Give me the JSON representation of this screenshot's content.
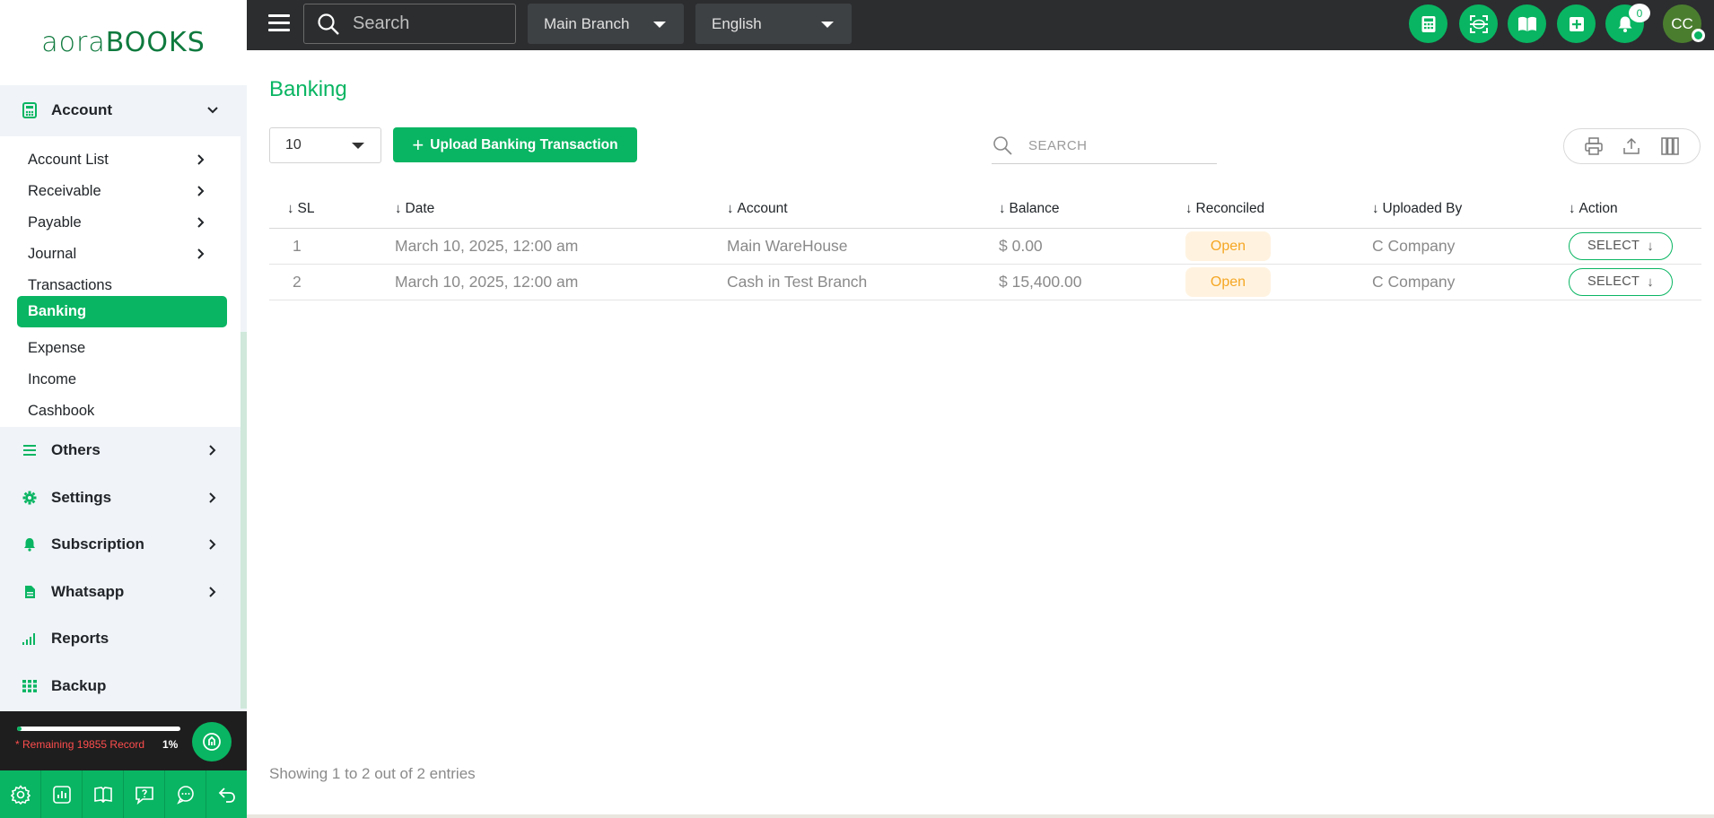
{
  "brand": {
    "logo_part1": "aora",
    "logo_part2": "BOOKS"
  },
  "sidebar": {
    "account_section": {
      "label": "Account",
      "icon": "calculator-icon",
      "expanded": true
    },
    "account_items": [
      {
        "label": "Account List",
        "has_children": true
      },
      {
        "label": "Receivable",
        "has_children": true
      },
      {
        "label": "Payable",
        "has_children": true
      },
      {
        "label": "Journal",
        "has_children": true
      },
      {
        "label": "Transactions",
        "has_children": false
      },
      {
        "label": "Banking",
        "has_children": false,
        "active": true
      },
      {
        "label": "Expense",
        "has_children": false
      },
      {
        "label": "Income",
        "has_children": false
      },
      {
        "label": "Cashbook",
        "has_children": false
      }
    ],
    "sections": [
      {
        "label": "Others",
        "icon": "list-icon"
      },
      {
        "label": "Settings",
        "icon": "gear-icon"
      },
      {
        "label": "Subscription",
        "icon": "bell-icon"
      },
      {
        "label": "Whatsapp",
        "icon": "document-icon"
      },
      {
        "label": "Reports",
        "icon": "signal-bars-icon"
      },
      {
        "label": "Backup",
        "icon": "grid-icon"
      }
    ],
    "usage": {
      "remaining_text": "* Remaining 19855 Record",
      "percent_text": "1%",
      "percent_value": 1
    },
    "footer_icons": [
      "gear-icon",
      "chart-icon",
      "book-icon",
      "help-icon",
      "chat-icon",
      "undo-icon"
    ]
  },
  "topbar": {
    "search_placeholder": "Search",
    "branch": "Main Branch",
    "language": "English",
    "notification_count": "0",
    "avatar_initials": "CC"
  },
  "main": {
    "title": "Banking",
    "page_size": "10",
    "upload_label": "Upload Banking Transaction",
    "search_placeholder": "SEARCH",
    "columns": [
      "SL",
      "Date",
      "Account",
      "Balance",
      "Reconciled",
      "Uploaded By",
      "Action"
    ],
    "rows": [
      {
        "sl": "1",
        "date": "March 10, 2025, 12:00 am",
        "account": "Main WareHouse",
        "balance": "$ 0.00",
        "reconciled": "Open",
        "uploaded_by": "C Company",
        "action": "SELECT"
      },
      {
        "sl": "2",
        "date": "March 10, 2025, 12:00 am",
        "account": "Cash in Test Branch",
        "balance": "$ 15,400.00",
        "reconciled": "Open",
        "uploaded_by": "C Company",
        "action": "SELECT"
      }
    ],
    "entries_text": "Showing 1 to 2 out of 2 entries"
  },
  "colors": {
    "brand_green": "#09b562",
    "topbar": "#2b2d2f",
    "open_text": "#f5a623",
    "open_bg": "#fff3e0"
  }
}
